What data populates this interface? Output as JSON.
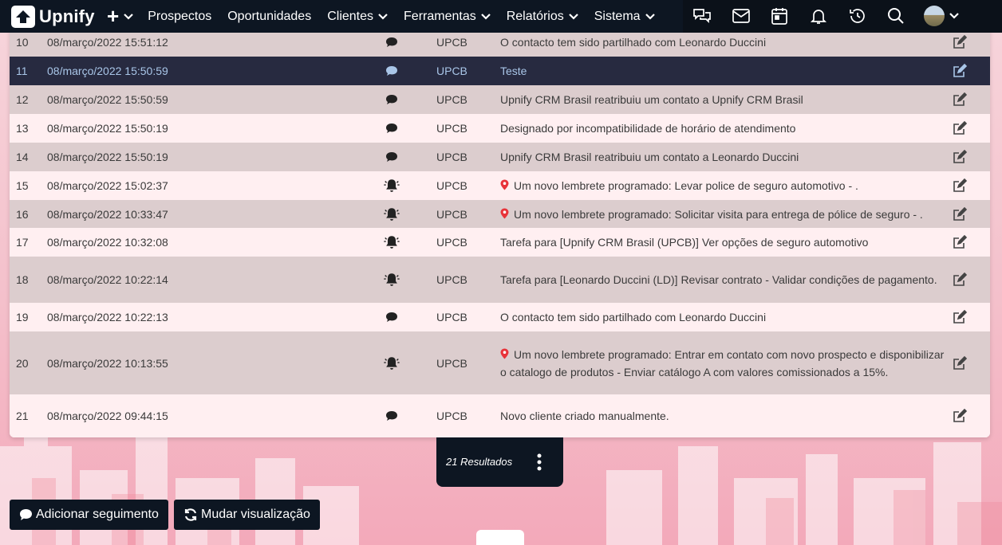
{
  "app": {
    "name": "Upnify"
  },
  "nav": {
    "items": [
      {
        "label": "Prospectos",
        "has_caret": false
      },
      {
        "label": "Oportunidades",
        "has_caret": false
      },
      {
        "label": "Clientes",
        "has_caret": true
      },
      {
        "label": "Ferramentas",
        "has_caret": true
      },
      {
        "label": "Relatórios",
        "has_caret": true
      },
      {
        "label": "Sistema",
        "has_caret": true
      }
    ],
    "right_icons": [
      "chat-bubbles-icon",
      "mail-icon",
      "calendar-icon",
      "bell-icon",
      "history-icon",
      "search-icon",
      "avatar",
      "chevron-down-icon"
    ]
  },
  "table": {
    "rows": [
      {
        "num": "10",
        "date": "08/março/2022 15:51:12",
        "icon": "comment-icon",
        "user": "UPCB",
        "desc": "O contacto tem sido partilhado com Leonardo Duccini",
        "pin": false
      },
      {
        "num": "11",
        "date": "08/março/2022 15:50:59",
        "icon": "comment-icon",
        "user": "UPCB",
        "desc": "Teste",
        "pin": false,
        "selected": true
      },
      {
        "num": "12",
        "date": "08/março/2022 15:50:59",
        "icon": "comment-icon",
        "user": "UPCB",
        "desc": "Upnify CRM Brasil reatribuiu um contato a Upnify CRM Brasil",
        "pin": false
      },
      {
        "num": "13",
        "date": "08/março/2022 15:50:19",
        "icon": "comment-icon",
        "user": "UPCB",
        "desc": "Designado por incompatibilidade de horário de atendimento",
        "pin": false
      },
      {
        "num": "14",
        "date": "08/março/2022 15:50:19",
        "icon": "comment-icon",
        "user": "UPCB",
        "desc": "Upnify CRM Brasil reatribuiu um contato a Leonardo Duccini",
        "pin": false
      },
      {
        "num": "15",
        "date": "08/março/2022 15:02:37",
        "icon": "bell-ring-icon",
        "user": "UPCB",
        "desc": "Um novo lembrete programado: Levar police de seguro automotivo - .",
        "pin": true
      },
      {
        "num": "16",
        "date": "08/março/2022 10:33:47",
        "icon": "bell-ring-icon",
        "user": "UPCB",
        "desc": "Um novo lembrete programado: Solicitar visita para entrega de pólice de seguro - .",
        "pin": true
      },
      {
        "num": "17",
        "date": "08/março/2022 10:32:08",
        "icon": "bell-ring-icon",
        "user": "UPCB",
        "desc": "Tarefa para [Upnify CRM Brasil (UPCB)] Ver opções de seguro automotivo",
        "pin": false
      },
      {
        "num": "18",
        "date": "08/março/2022 10:22:14",
        "icon": "bell-ring-icon",
        "user": "UPCB",
        "desc": "Tarefa para [Leonardo Duccini (LD)] Revisar contrato - Validar condições de pagamento.",
        "pin": false
      },
      {
        "num": "19",
        "date": "08/março/2022 10:22:13",
        "icon": "comment-icon",
        "user": "UPCB",
        "desc": "O contacto tem sido partilhado com Leonardo Duccini",
        "pin": false
      },
      {
        "num": "20",
        "date": "08/março/2022 10:13:55",
        "icon": "bell-ring-icon",
        "user": "UPCB",
        "desc": "Um novo lembrete programado: Entrar em contato com novo prospecto e disponibilizar o catalogo de produtos - Enviar catálogo A com valores comissionados a 15%.",
        "pin": true
      },
      {
        "num": "21",
        "date": "08/março/2022 09:44:15",
        "icon": "comment-icon",
        "user": "UPCB",
        "desc": "Novo cliente criado manualmente.",
        "pin": false
      }
    ]
  },
  "footer": {
    "results_label": "21 Resultados",
    "add_followup_label": "Adicionar seguimento",
    "change_view_label": "Mudar visualização"
  },
  "colors": {
    "nav_bg": "#0d1622",
    "selected_row_bg": "#272a40",
    "pin_red": "#e8333a"
  }
}
